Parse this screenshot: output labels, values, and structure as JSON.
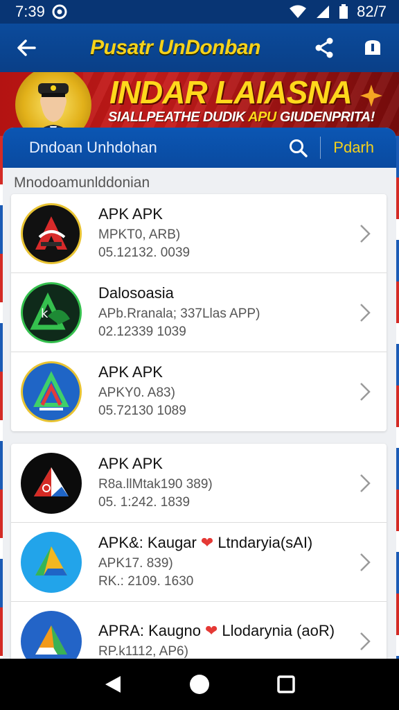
{
  "status_bar": {
    "time": "7:39",
    "battery": "82/7"
  },
  "app_bar": {
    "title": "Pusatr UnDonban",
    "back_icon": "arrow-left-icon",
    "share_icon": "share-icon",
    "profile_icon": "bookmark-icon"
  },
  "banner": {
    "headline": "INDAR LAIASNA",
    "subline_part1": "SIALLPEATHE DUDIK ",
    "subline_highlight": "APU",
    "subline_part2": " GIUDENPRITA!"
  },
  "search": {
    "label": "Dndoan Unhdohan",
    "action": "Pdarh"
  },
  "section": {
    "title": "Mnodoamunlddonian"
  },
  "groups": [
    {
      "items": [
        {
          "name": "APK APK",
          "meta1": "MPKT0, ARB)",
          "meta2": "05.12132. 0039",
          "colors": [
            "#111111",
            "#d82a2a",
            "#2c2c2c"
          ]
        },
        {
          "name": "Dalosoasia",
          "meta1": "APb.Rranala; 337Llas APP)",
          "meta2": "02.12339 1039",
          "colors": [
            "#0f2a1a",
            "#35c04e",
            "#1e8a35"
          ]
        },
        {
          "name": "APK APK",
          "meta1": "APKY0. A83)",
          "meta2": "05.72130 1089",
          "colors": [
            "#1f65c6",
            "#3fd06a",
            "#e23b3b"
          ]
        }
      ]
    },
    {
      "items": [
        {
          "name": "APK APK",
          "meta1": "R8a.llMtak190 389)",
          "meta2": "05. 1:242. 1839",
          "colors": [
            "#0b0b0b",
            "#d42b25",
            "#ffffff"
          ]
        },
        {
          "name_part1": "APK&: Kaugar",
          "name_part2": "Ltndaryia(sAI)",
          "meta1": "APK17. 839)",
          "meta2": "RK.: 2109. 1630",
          "colors": [
            "#22a4ea",
            "#34b557",
            "#f2b721"
          ]
        },
        {
          "name_part1": "APRA: Kaugno",
          "name_part2": "Llodarynia (aoR)",
          "meta1": "RP.k1112, AP6)",
          "meta2": "",
          "colors": [
            "#2364c7",
            "#f29a1b",
            "#3ab255"
          ]
        }
      ]
    }
  ],
  "nav_bar": {
    "back_icon": "triangle-back-icon",
    "home_icon": "circle-home-icon",
    "recents_icon": "square-recents-icon"
  }
}
